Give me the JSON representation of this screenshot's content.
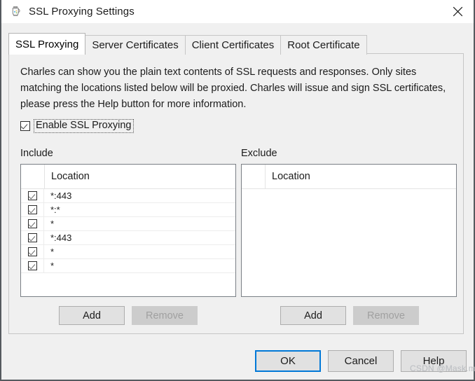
{
  "window": {
    "title": "SSL Proxying Settings",
    "icon": "charles-jug-icon",
    "close_icon": "close-icon"
  },
  "tabs": [
    {
      "label": "SSL Proxying",
      "active": true
    },
    {
      "label": "Server Certificates",
      "active": false
    },
    {
      "label": "Client Certificates",
      "active": false
    },
    {
      "label": "Root Certificate",
      "active": false
    }
  ],
  "panel": {
    "description": "Charles can show you the plain text contents of SSL requests and responses. Only sites matching the locations listed below will be proxied. Charles will issue and sign SSL certificates, please press the Help button for more information.",
    "enable": {
      "label": "Enable SSL Proxying",
      "checked": true
    },
    "include": {
      "section_label": "Include",
      "column_header": "Location",
      "rows": [
        {
          "checked": true,
          "location": "*:443"
        },
        {
          "checked": true,
          "location": "*:*"
        },
        {
          "checked": true,
          "location": "*"
        },
        {
          "checked": true,
          "location": "*:443"
        },
        {
          "checked": true,
          "location": "*"
        },
        {
          "checked": true,
          "location": "*"
        }
      ],
      "add_label": "Add",
      "remove_label": "Remove",
      "remove_enabled": false
    },
    "exclude": {
      "section_label": "Exclude",
      "column_header": "Location",
      "rows": [],
      "add_label": "Add",
      "remove_label": "Remove",
      "remove_enabled": false
    }
  },
  "footer": {
    "ok_label": "OK",
    "cancel_label": "Cancel",
    "help_label": "Help",
    "default_button": "OK"
  },
  "watermark": "CSDN @Mask.m",
  "colors": {
    "dialog_bg": "#f0f0f0",
    "titlebar_bg": "#ffffff",
    "accent_focus": "#0078d7",
    "border": "#7a7f85",
    "text": "#1b1b1b",
    "disabled_text": "#a0a0a0",
    "watermark": "#b9bcc0"
  }
}
